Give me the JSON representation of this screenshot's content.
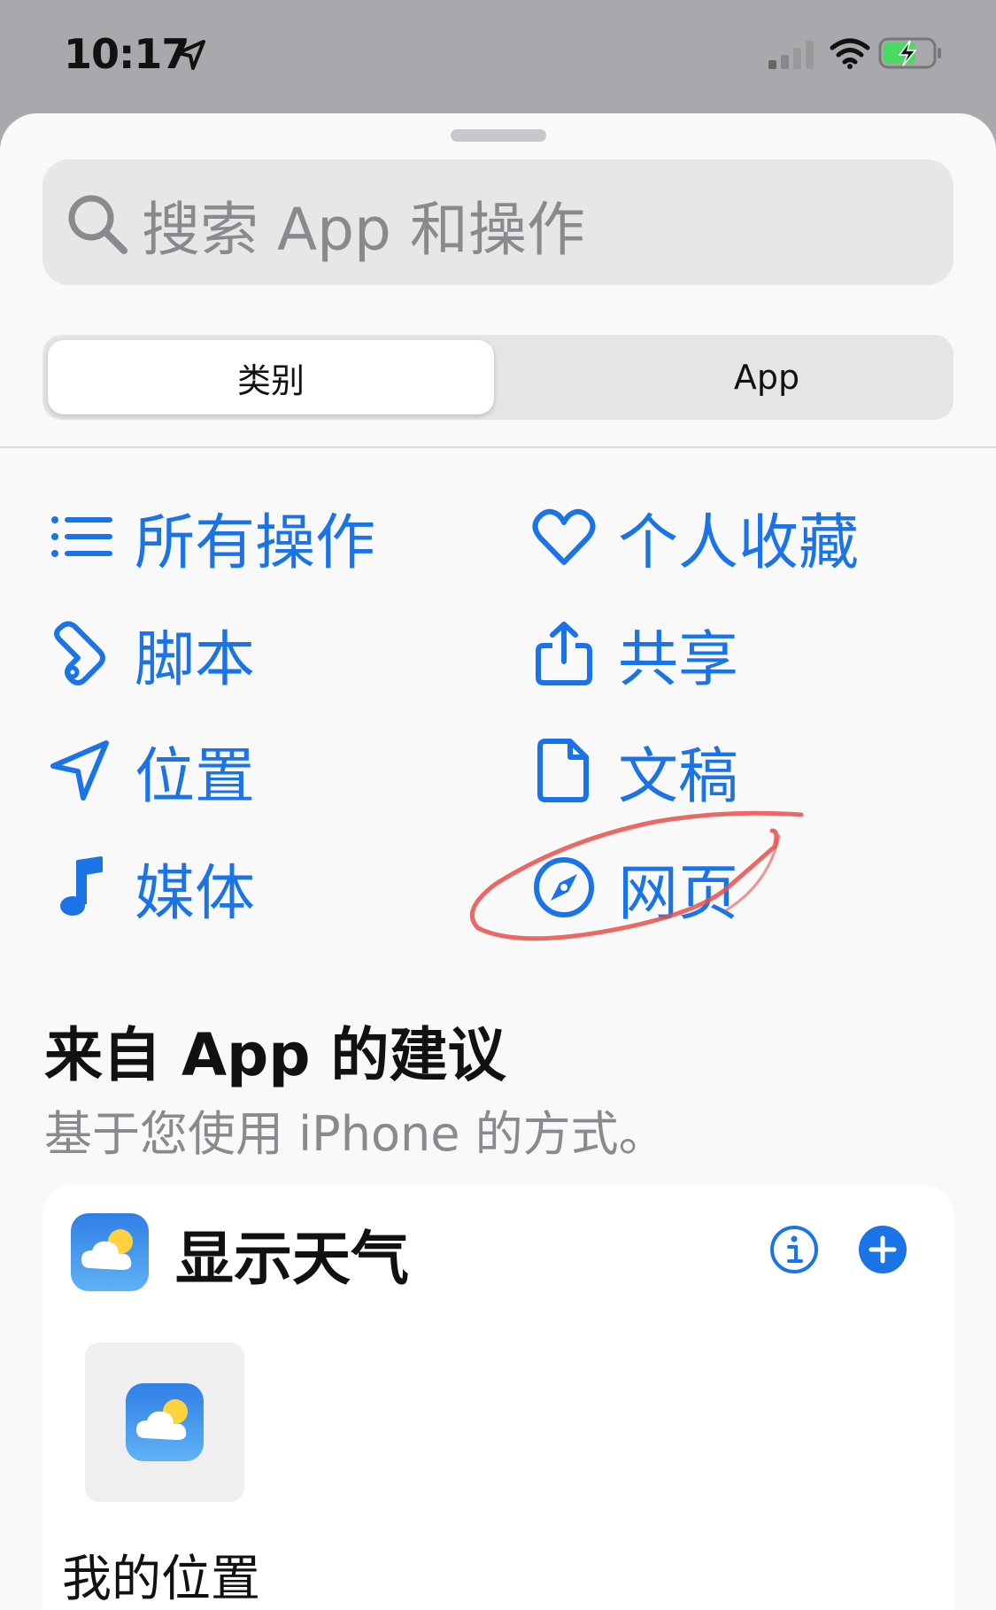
{
  "status_bar": {
    "time": "10:17"
  },
  "search": {
    "placeholder": "搜索 App 和操作"
  },
  "segments": {
    "category_label": "类别",
    "app_label": "App",
    "selected": "类别"
  },
  "categories": {
    "all_actions": "所有操作",
    "favorites": "个人收藏",
    "scripting": "脚本",
    "sharing": "共享",
    "location": "位置",
    "documents": "文稿",
    "media": "媒体",
    "web": "网页"
  },
  "suggestions": {
    "title": "来自 App 的建议",
    "subtitle": "基于您使用 iPhone 的方式。",
    "card": {
      "title": "显示天气",
      "tile_label": "我的位置"
    }
  },
  "colors": {
    "accent": "#1a74e8",
    "annotation": "#e8504a",
    "sheet_bg": "#f9f9fa"
  },
  "icons": [
    "location-arrow-icon",
    "signal-icon",
    "wifi-icon",
    "battery-charging-icon",
    "search-icon",
    "list-icon",
    "heart-icon",
    "scroll-icon",
    "share-icon",
    "location-icon",
    "document-icon",
    "music-note-icon",
    "compass-icon",
    "weather-app-icon",
    "info-icon",
    "add-icon"
  ]
}
